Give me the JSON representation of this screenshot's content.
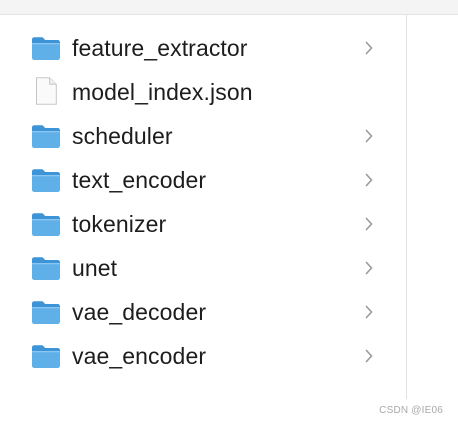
{
  "file_list": {
    "items": [
      {
        "name": "feature_extractor",
        "kind": "folder",
        "icon": "folder-icon",
        "has_children": true
      },
      {
        "name": "model_index.json",
        "kind": "file",
        "icon": "document-icon",
        "has_children": false
      },
      {
        "name": "scheduler",
        "kind": "folder",
        "icon": "folder-icon",
        "has_children": true
      },
      {
        "name": "text_encoder",
        "kind": "folder",
        "icon": "folder-icon",
        "has_children": true
      },
      {
        "name": "tokenizer",
        "kind": "folder",
        "icon": "folder-icon",
        "has_children": true
      },
      {
        "name": "unet",
        "kind": "folder",
        "icon": "folder-icon",
        "has_children": true
      },
      {
        "name": "vae_decoder",
        "kind": "folder",
        "icon": "folder-icon",
        "has_children": true
      },
      {
        "name": "vae_encoder",
        "kind": "folder",
        "icon": "folder-icon",
        "has_children": true
      }
    ]
  },
  "watermark": {
    "text": "CSDN @IE06"
  },
  "colors": {
    "folder_body": "#5fb0e8",
    "folder_tab": "#3d94d6",
    "document_fill": "#fafafa",
    "document_stroke": "#c7c7c7",
    "chevron": "#9a9a9a",
    "label_text": "#1d1d1f"
  }
}
